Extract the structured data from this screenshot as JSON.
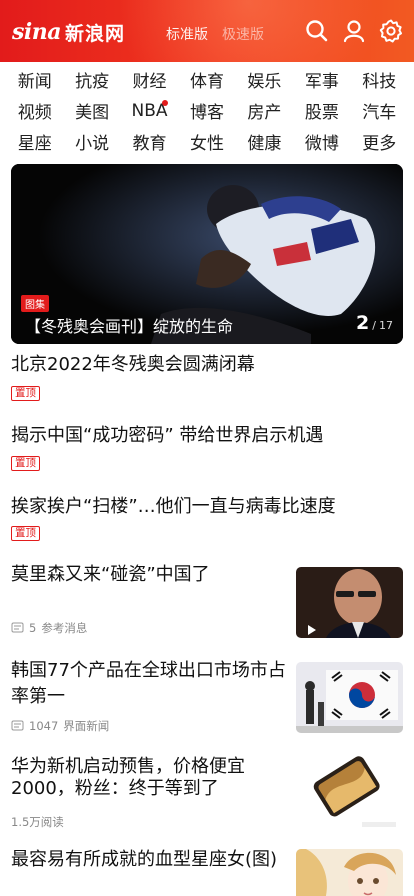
{
  "header": {
    "logo_sina": "sina",
    "logo_cn": "新浪网",
    "version_standard": "标准版",
    "version_alt": "极速版",
    "icons": [
      "search-icon",
      "user-icon",
      "gear-icon"
    ],
    "brand_color": "#e21b1b"
  },
  "channels": [
    {
      "label": "新闻"
    },
    {
      "label": "抗疫"
    },
    {
      "label": "财经"
    },
    {
      "label": "体育"
    },
    {
      "label": "娱乐"
    },
    {
      "label": "军事"
    },
    {
      "label": "科技"
    },
    {
      "label": "视频"
    },
    {
      "label": "美图"
    },
    {
      "label": "NBA",
      "dot": true
    },
    {
      "label": "博客"
    },
    {
      "label": "房产"
    },
    {
      "label": "股票"
    },
    {
      "label": "汽车"
    },
    {
      "label": "星座"
    },
    {
      "label": "小说"
    },
    {
      "label": "教育"
    },
    {
      "label": "女性"
    },
    {
      "label": "健康"
    },
    {
      "label": "微博"
    },
    {
      "label": "更多"
    }
  ],
  "hero": {
    "tag": "图集",
    "caption": "【冬残奥会画刊】绽放的生命",
    "page_current": "2",
    "page_sep": "/",
    "page_total": "17"
  },
  "articles": [
    {
      "title": "北京2022年冬残奥会圆满闭幕",
      "badge": "置顶"
    },
    {
      "title": "揭示中国“成功密码” 带给世界启示机遇",
      "badge": "置顶"
    },
    {
      "title": "挨家挨户“扫楼”…他们一直与病毒比速度",
      "badge": "置顶"
    },
    {
      "title": "莫里森又来“碰瓷”中国了",
      "comments": "5",
      "source": "参考消息",
      "thumb": "portrait-thumbnail"
    },
    {
      "title_l1": "韩国77个产品在全球出口市场市占",
      "title_l2": "率第一",
      "comments": "1047",
      "source": "界面新闻",
      "thumb": "flag-thumbnail"
    },
    {
      "title_l1": "华为新机启动预售，价格便宜",
      "title_l2": "2000，粉丝：终于等到了",
      "reads": "1.5万阅读",
      "thumb": "phone-thumbnail"
    },
    {
      "title": "最容易有所成就的血型星座女(图)",
      "thumb": "illustration-thumbnail"
    }
  ]
}
